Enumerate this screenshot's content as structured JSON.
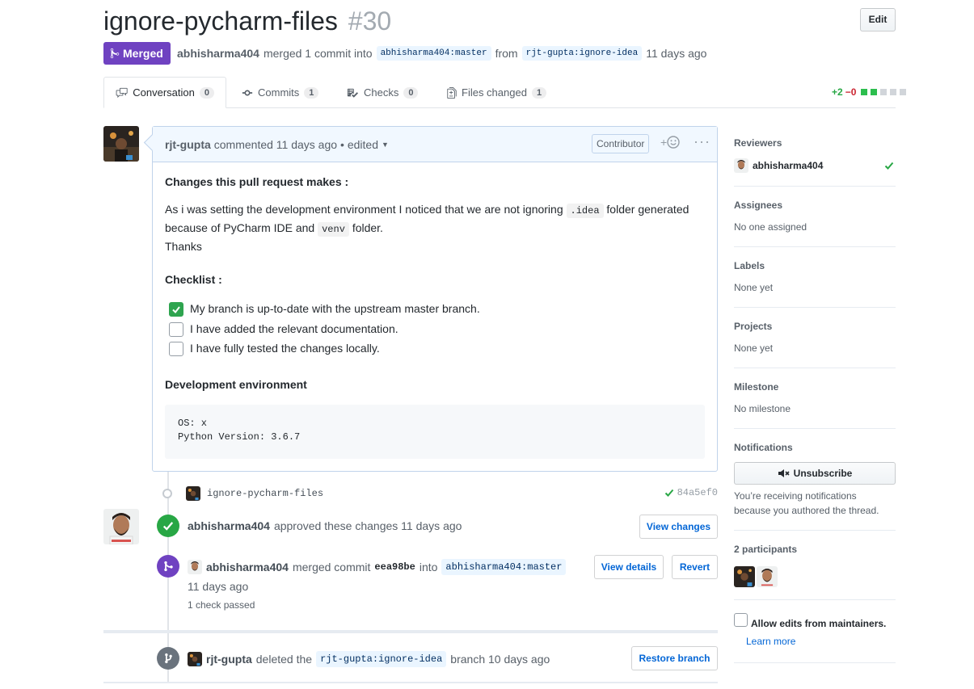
{
  "header": {
    "title": "ignore-pycharm-files",
    "number": "#30",
    "edit_label": "Edit",
    "state_label": "Merged",
    "merger": "abhisharma404",
    "merged_text": "merged 1 commit into",
    "base_ref": "abhisharma404:master",
    "from_text": "from",
    "head_ref": "rjt-gupta:ignore-idea",
    "time": "11 days ago"
  },
  "tabs": [
    {
      "label": "Conversation",
      "count": "0"
    },
    {
      "label": "Commits",
      "count": "1"
    },
    {
      "label": "Checks",
      "count": "0"
    },
    {
      "label": "Files changed",
      "count": "1"
    }
  ],
  "diffstat": {
    "additions": "+2",
    "deletions": "−0"
  },
  "comment": {
    "author": "rjt-gupta",
    "action": "commented 11 days ago",
    "edited": "• edited",
    "role_badge": "Contributor",
    "heading1": "Changes this pull request makes :",
    "para_a": "As i was setting the development environment I noticed that we are not ignoring",
    "code1": ".idea",
    "para_b": "folder generated",
    "para_c": "because of PyCharm IDE and",
    "code2": "venv",
    "para_d": "folder.",
    "thanks": "Thanks",
    "heading2": "Checklist :",
    "tasks": [
      {
        "label": "My branch is up-to-date with the upstream master branch.",
        "checked": true
      },
      {
        "label": "I have added the relevant documentation.",
        "checked": false
      },
      {
        "label": "I have fully tested the changes locally.",
        "checked": false
      }
    ],
    "heading3": "Development environment",
    "code_block": "OS: x\nPython Version: 3.6.7"
  },
  "commit": {
    "message": "ignore-pycharm-files",
    "sha": "84a5ef0"
  },
  "review": {
    "author": "abhisharma404",
    "text": "approved these changes 11 days ago",
    "button": "View changes"
  },
  "merge_event": {
    "author": "abhisharma404",
    "text": "merged commit",
    "sha": "eea98be",
    "into": "into",
    "ref": "abhisharma404:master",
    "time": "11 days ago",
    "checks": "1 check passed",
    "details_button": "View details",
    "revert_button": "Revert"
  },
  "delete_event": {
    "author": "rjt-gupta",
    "text": "deleted the",
    "ref": "rjt-gupta:ignore-idea",
    "tail": "branch 10 days ago",
    "button": "Restore branch"
  },
  "sidebar": {
    "reviewers": {
      "heading": "Reviewers",
      "name": "abhisharma404"
    },
    "assignees": {
      "heading": "Assignees",
      "value": "No one assigned"
    },
    "labels": {
      "heading": "Labels",
      "value": "None yet"
    },
    "projects": {
      "heading": "Projects",
      "value": "None yet"
    },
    "milestone": {
      "heading": "Milestone",
      "value": "No milestone"
    },
    "notifications": {
      "heading": "Notifications",
      "button": "Unsubscribe",
      "note_line1": "You’re receiving notifications",
      "note_line2": "because you authored the thread."
    },
    "participants": {
      "heading": "2 participants"
    },
    "allow_edits": "Allow edits from maintainers.",
    "learn_more": "Learn more"
  },
  "colors": {
    "merged": "#6f42c1",
    "success": "#28a745",
    "link": "#0366d6",
    "danger": "#cb2431"
  }
}
